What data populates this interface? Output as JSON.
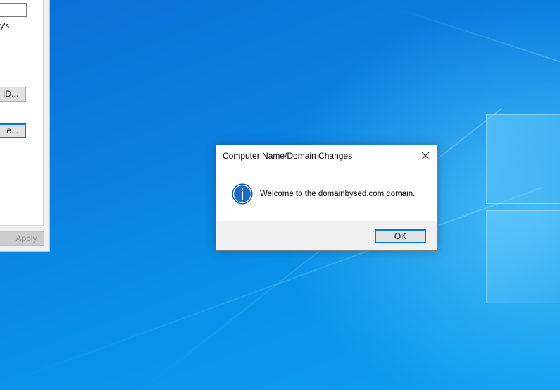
{
  "background_window": {
    "fragment_text": "y's",
    "id_button_label": "ID...",
    "change_button_label": "e...",
    "apply_button_label": "Apply"
  },
  "dialog": {
    "title": "Computer Name/Domain Changes",
    "message": "Welcome to the domainbysed.com domain.",
    "ok_label": "OK",
    "icon": "info-icon",
    "close_icon": "close-icon"
  },
  "colors": {
    "desktop_blue": "#0a7fe0",
    "accent": "#0078d7",
    "info_icon": "#1c6bc6"
  }
}
